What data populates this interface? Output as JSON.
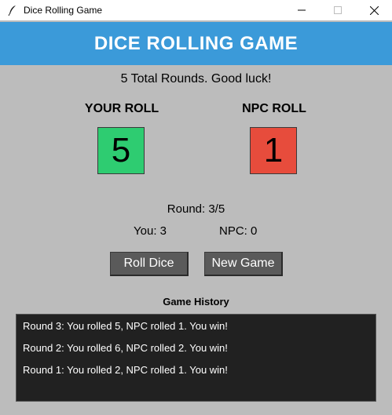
{
  "window": {
    "title": "Dice Rolling Game",
    "controls": {
      "minimize": "minimize-icon",
      "maximize": "maximize-icon",
      "close": "close-icon"
    }
  },
  "header": {
    "title": "DICE ROLLING GAME",
    "color": "#3b9ad9"
  },
  "subtitle": "5 Total Rounds. Good luck!",
  "player": {
    "label": "YOUR ROLL",
    "value": "5",
    "color": "#2ecc71"
  },
  "npc": {
    "label": "NPC ROLL",
    "value": "1",
    "color": "#e74c3c"
  },
  "round": "Round: 3/5",
  "scores": {
    "you": "You: 3",
    "npc": "NPC: 0"
  },
  "buttons": {
    "roll": "Roll Dice",
    "new_game": "New Game"
  },
  "history": {
    "title": "Game History",
    "entries": [
      "Round 3: You rolled 5, NPC rolled 1. You win!",
      "Round 2: You rolled 6, NPC rolled 2. You win!",
      "Round 1: You rolled 2, NPC rolled 1. You win!"
    ]
  }
}
